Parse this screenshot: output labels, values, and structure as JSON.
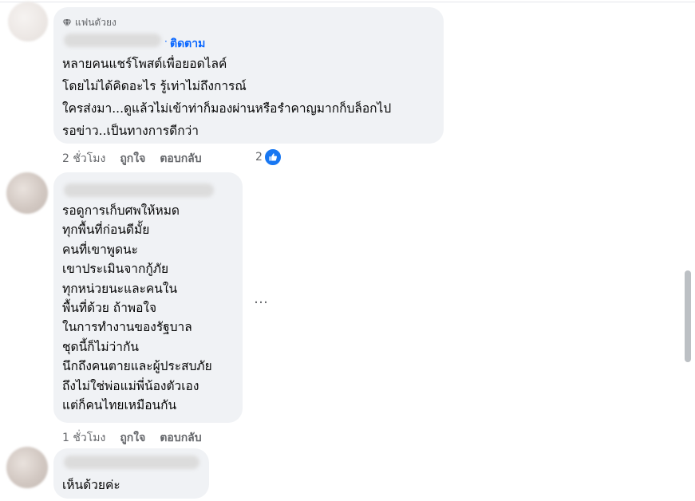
{
  "comments": [
    {
      "badge": "แฟนตัวยง",
      "separator": "·",
      "follow_label": "ติดตาม",
      "text": "หลายคนแชร์โพสต์เพื่อยอดไลค์\nโดยไม่ได้คิดอะไร รู้เท่าไม่ถึงการณ์\nใครส่งมา...ดูแล้วไม่เข้าท่าก็มองผ่านหรือรำคาญมากก็บล็อกไป\nรอข่าว..เป็นทางการดีกว่า",
      "time": "2 ชั่วโมง",
      "like": "ถูกใจ",
      "reply": "ตอบกลับ",
      "reaction_count": "2",
      "reaction_icon": "like-icon"
    },
    {
      "text": "รอดูการเก็บศพให้หมด\nทุกพื้นที่ก่อนดีมั้ย\nคนที่เขาพูดนะ\nเขาประเมินจากกู้ภัย\nทุกหน่วยนะและคนใน\nพื้นที่ด้วย ถ้าพอใจ\nในการทำงานของรัฐบาล\nชุดนี้ก็ไม่ว่ากัน\nนึกถึงคนตายและผู้ประสบภัย\nถึงไม่ใช่พ่อแม่พี่น้องตัวเอง\nแต่ก็คนไทยเหมือนกัน",
      "time": "1 ชั่วโมง",
      "like": "ถูกใจ",
      "reply": "ตอบกลับ",
      "more_label": "…"
    },
    {
      "text": "เห็นด้วยค่ะ"
    }
  ],
  "colors": {
    "bubble": "#f0f2f5",
    "link_blue": "#0866ff",
    "meta_gray": "#65676b",
    "like_blue": "#1877f2"
  }
}
